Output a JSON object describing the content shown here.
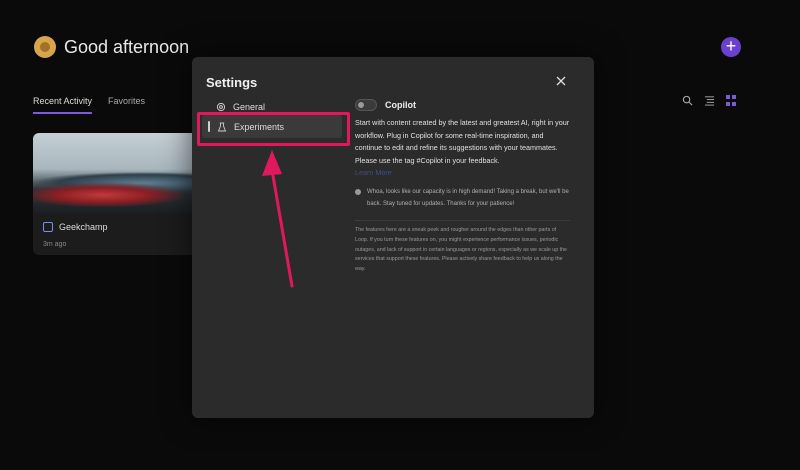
{
  "app": {
    "greeting": "Good afternoon",
    "add_label": "+",
    "tabs": [
      {
        "label": "Recent Activity",
        "active": true
      },
      {
        "label": "Favorites",
        "active": false
      }
    ],
    "toolbar_icons": [
      "search-icon",
      "list-view-icon",
      "grid-view-icon"
    ],
    "recent_card": {
      "title": "Geekchamp",
      "time": "3m ago",
      "icon": "loop-page-icon"
    }
  },
  "settings": {
    "title": "Settings",
    "close_icon": "close-icon",
    "nav": [
      {
        "label": "General",
        "icon": "gear-icon",
        "selected": false
      },
      {
        "label": "Experiments",
        "icon": "beaker-icon",
        "selected": true
      }
    ],
    "copilot": {
      "toggle_label": "Copilot",
      "toggle_on": false,
      "description": "Start with content created by the latest and greatest AI, right in your workflow. Plug in Copilot for some real-time inspiration, and continue to edit and refine its suggestions with your teammates. Please use the tag #Copilot in your feedback.",
      "learn_more": "Learn More",
      "notice": "Whoa, looks like our capacity is in high demand! Taking a break, but we'll be back. Stay tuned for updates. Thanks for your patience!",
      "disclaimer": "The features here are a sneak peek and rougher around the edges than other parts of Loop. If you turn these features on, you might experience performance issues, periodic outages, and lack of support in certain languages or regions, especially as we scale up the services that support these features. Please actively share feedback to help us along the way."
    }
  },
  "colors": {
    "accent": "#6b3fd0",
    "highlight_annotation": "#e0195e"
  }
}
